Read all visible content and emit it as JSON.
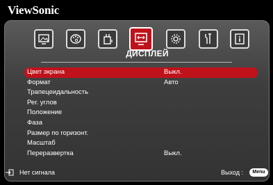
{
  "brand": "ViewSonic",
  "active_tab_title": "ДИСПЛЕЙ",
  "tabs": [
    {
      "icon": "picture-icon"
    },
    {
      "icon": "color-palette-icon"
    },
    {
      "icon": "power-plug-icon"
    },
    {
      "icon": "display-icon"
    },
    {
      "icon": "settings-gear-icon"
    },
    {
      "icon": "tools-icon"
    },
    {
      "icon": "info-icon"
    }
  ],
  "menu": [
    {
      "label": "Цвет экрана",
      "value": "Выкл.",
      "selected": true
    },
    {
      "label": "Формат",
      "value": "Авто"
    },
    {
      "label": "Трапецеидальность",
      "value": ""
    },
    {
      "label": "Рег. углов",
      "value": ""
    },
    {
      "label": "Положение",
      "value": ""
    },
    {
      "label": "Фаза",
      "value": ""
    },
    {
      "label": "Размер по горизонт.",
      "value": ""
    },
    {
      "label": "Масштаб",
      "value": ""
    },
    {
      "label": "Переразвертка",
      "value": "Выкл."
    }
  ],
  "footer": {
    "status": "Нет сигнала",
    "exit_label": "Выход :",
    "menu_button": "Menu"
  },
  "colors": {
    "accent": "#c0121b"
  }
}
